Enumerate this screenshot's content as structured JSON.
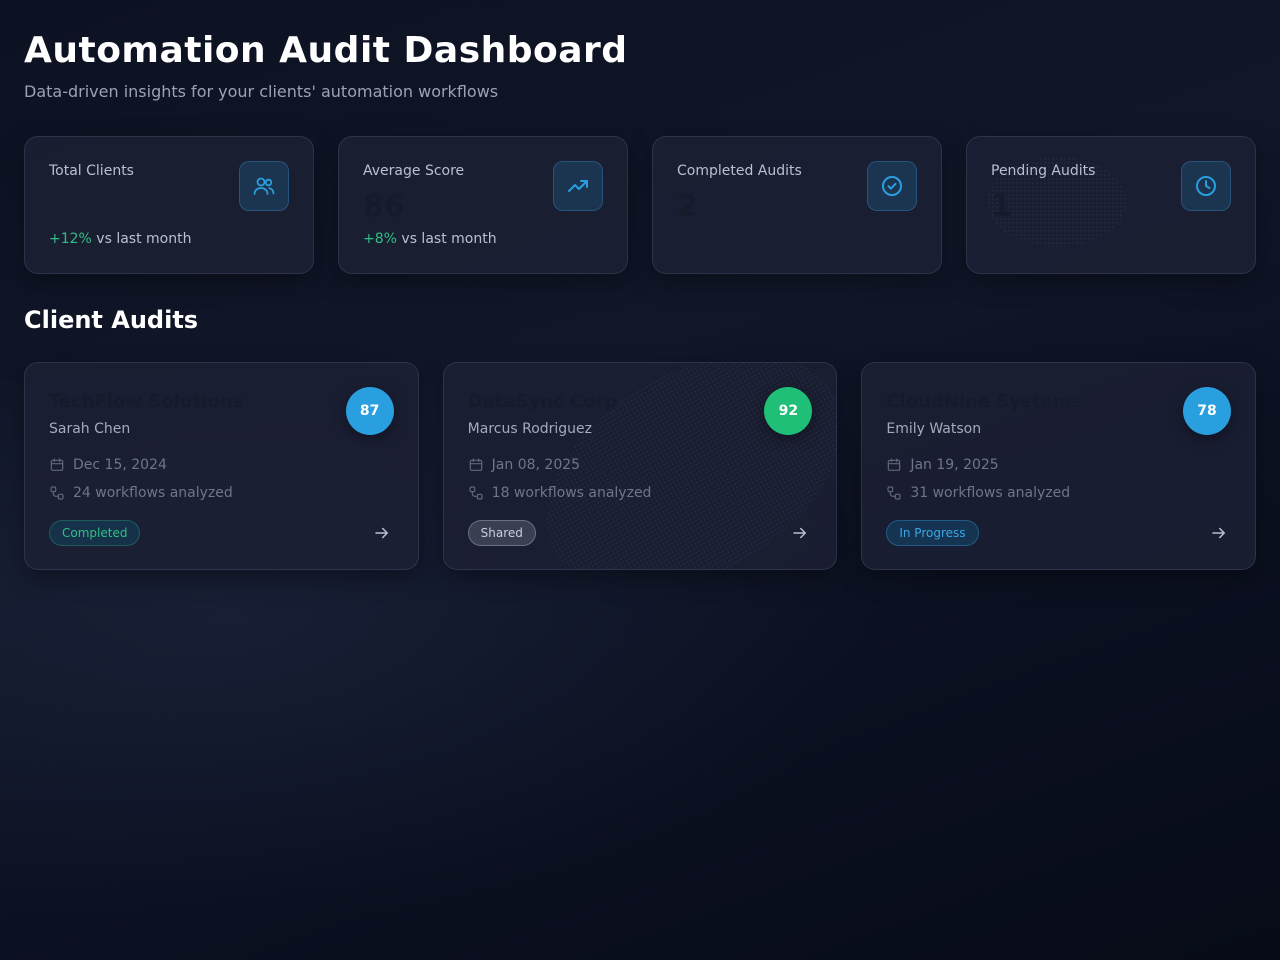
{
  "header": {
    "title": "Automation Audit Dashboard",
    "subtitle": "Data-driven insights for your clients' automation workflows"
  },
  "stats": [
    {
      "label": "Total Clients",
      "value": "",
      "change": "+12%",
      "change_suffix": " vs last month",
      "icon": "users-icon"
    },
    {
      "label": "Average Score",
      "value": "86",
      "change": "+8%",
      "change_suffix": " vs last month",
      "icon": "trending-up-icon"
    },
    {
      "label": "Completed Audits",
      "value": "2",
      "change": "",
      "change_suffix": "",
      "icon": "check-circle-icon"
    },
    {
      "label": "Pending Audits",
      "value": "1",
      "change": "",
      "change_suffix": "",
      "icon": "clock-icon"
    }
  ],
  "section": {
    "title": "Client Audits"
  },
  "audits": [
    {
      "client": "TechFlow Solutions",
      "contact": "Sarah Chen",
      "score": "87",
      "score_color": "#2a9fe0",
      "date": "Dec 15, 2024",
      "workflows": "24 workflows analyzed",
      "status": "Completed"
    },
    {
      "client": "DataSync Corp",
      "contact": "Marcus Rodriguez",
      "score": "92",
      "score_color": "#1fbf77",
      "date": "Jan 08, 2025",
      "workflows": "18 workflows analyzed",
      "status": "Shared"
    },
    {
      "client": "CloudNine Systems",
      "contact": "Emily Watson",
      "score": "78",
      "score_color": "#2a9fe0",
      "date": "Jan 19, 2025",
      "workflows": "31 workflows analyzed",
      "status": "In Progress"
    }
  ],
  "colors": {
    "accent": "#2a9fe0",
    "positive": "#2fbf86",
    "score_high": "#1fbf77"
  }
}
